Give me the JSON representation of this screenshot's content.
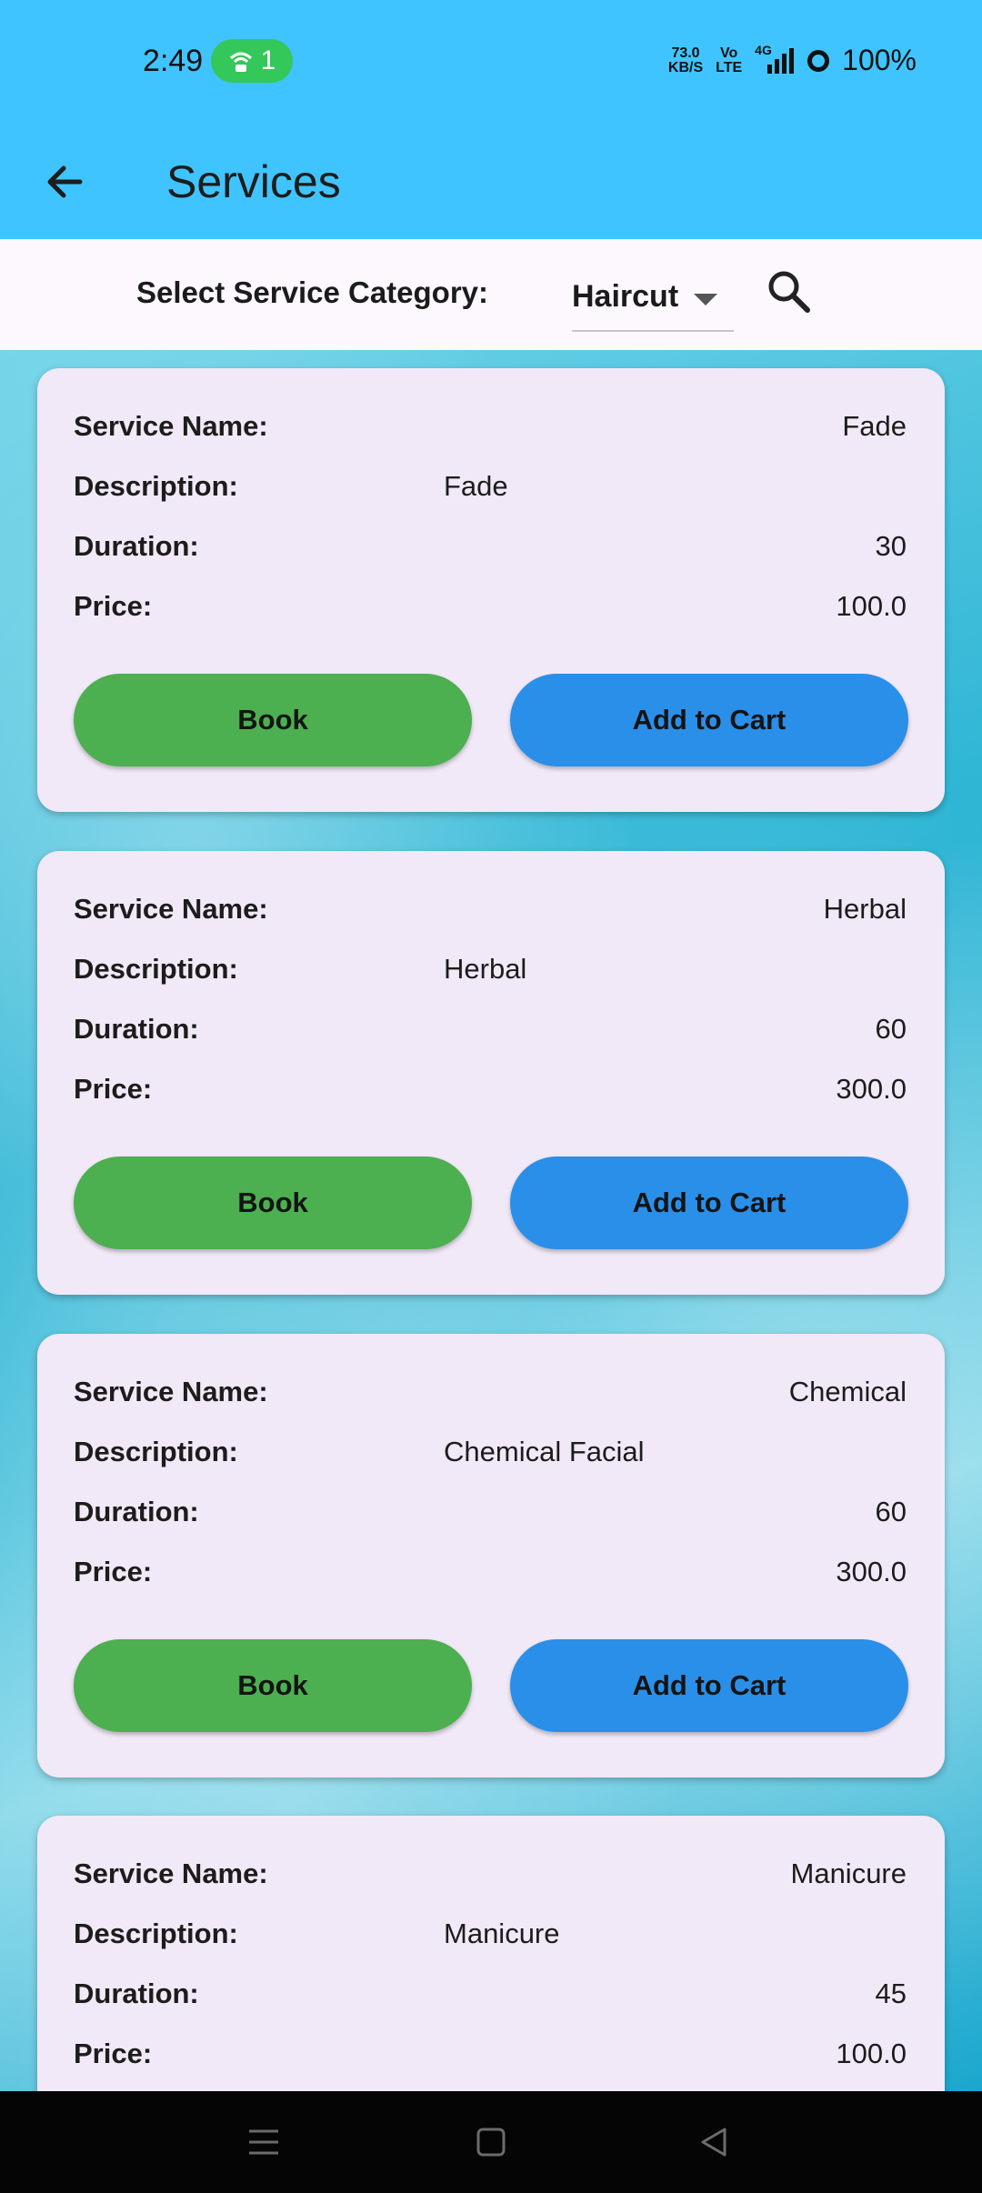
{
  "status": {
    "time": "2:49",
    "hotspot_count": "1",
    "net_speed_top": "73.0",
    "net_speed_bottom": "KB/S",
    "volte_top": "Vo",
    "volte_bottom": "LTE",
    "signal_label": "4G",
    "battery": "100%"
  },
  "appbar": {
    "title": "Services"
  },
  "filter": {
    "label": "Select Service Category:",
    "selected_category": "Haircut"
  },
  "field_labels": {
    "name": "Service Name:",
    "description": "Description:",
    "duration": "Duration:",
    "price": "Price:"
  },
  "buttons": {
    "book": "Book",
    "add_to_cart": "Add to Cart"
  },
  "services": [
    {
      "name": "Fade",
      "description": "Fade",
      "duration": "30",
      "price": "100.0"
    },
    {
      "name": "Herbal",
      "description": "Herbal",
      "duration": "60",
      "price": "300.0"
    },
    {
      "name": "Chemical",
      "description": "Chemical Facial",
      "duration": "60",
      "price": "300.0"
    },
    {
      "name": "Manicure",
      "description": "Manicure",
      "duration": "45",
      "price": "100.0"
    }
  ],
  "icons": {
    "back": "arrow-left-icon",
    "search": "search-icon",
    "nav_menu": "menu-icon",
    "nav_home": "home-square-icon",
    "nav_back": "back-triangle-icon"
  }
}
